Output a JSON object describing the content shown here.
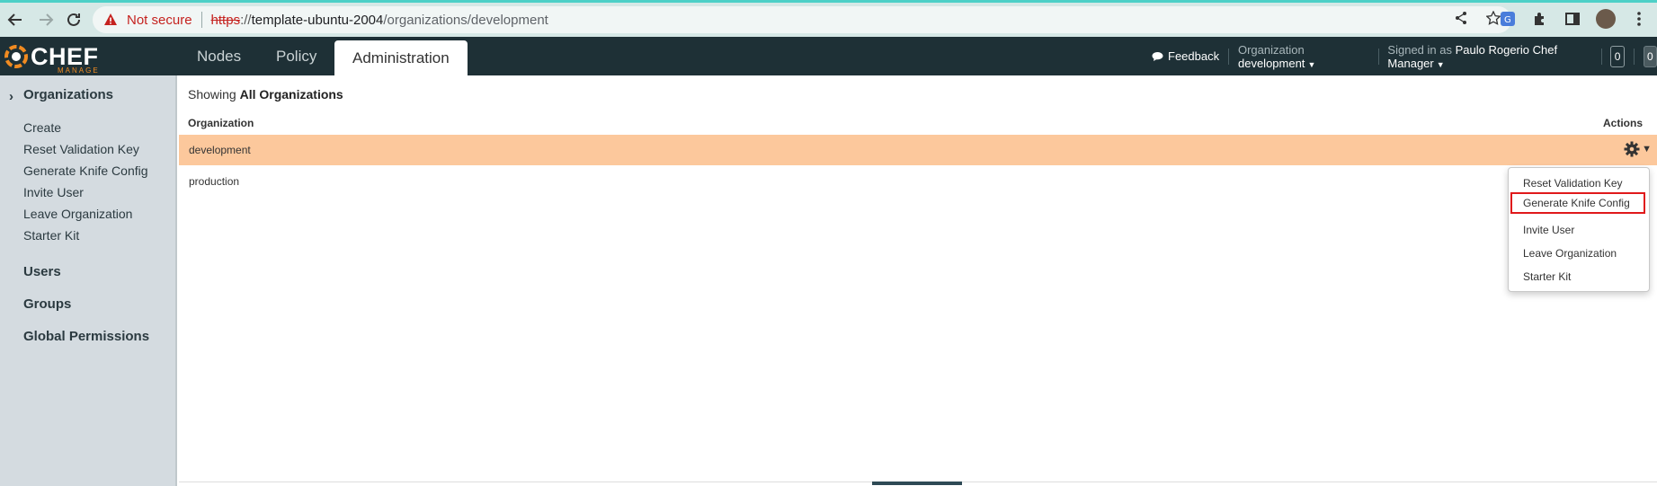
{
  "browser": {
    "security_label": "Not secure",
    "url_scheme": "https",
    "url_separator": "://",
    "url_host": "template-ubuntu-2004",
    "url_path": "/organizations/development"
  },
  "app": {
    "logo_text": "CHEF",
    "logo_subtext": "MANAGE",
    "tabs": [
      {
        "label": "Nodes"
      },
      {
        "label": "Policy"
      },
      {
        "label": "Administration"
      }
    ],
    "feedback_label": "Feedback",
    "org_prefix": "Organization",
    "org_value": "development",
    "signed_prefix": "Signed in as",
    "signed_user": "Paulo Rogerio Chef Manager",
    "count_1": "0",
    "count_2": "0"
  },
  "sidebar": {
    "organizations_heading": "Organizations",
    "items": [
      {
        "label": "Create"
      },
      {
        "label": "Reset Validation Key"
      },
      {
        "label": "Generate Knife Config"
      },
      {
        "label": "Invite User"
      },
      {
        "label": "Leave Organization"
      },
      {
        "label": "Starter Kit"
      }
    ],
    "users_heading": "Users",
    "groups_heading": "Groups",
    "global_permissions_heading": "Global Permissions"
  },
  "main": {
    "showing_prefix": "Showing",
    "showing_value": "All Organizations",
    "columns": {
      "organization": "Organization",
      "actions": "Actions"
    },
    "rows": [
      {
        "name": "development",
        "selected": true
      },
      {
        "name": "production",
        "selected": false
      }
    ]
  },
  "dropdown": {
    "items": [
      {
        "label": "Reset Validation Key"
      },
      {
        "label": "Generate Knife Config",
        "highlighted": true
      },
      {
        "label": "Invite User"
      },
      {
        "label": "Leave Organization"
      },
      {
        "label": "Starter Kit"
      }
    ]
  },
  "colors": {
    "navbar": "#1e3036",
    "selected_row": "#fcc89c",
    "brand_orange": "#f18b21",
    "highlight_border": "#e0191b"
  }
}
